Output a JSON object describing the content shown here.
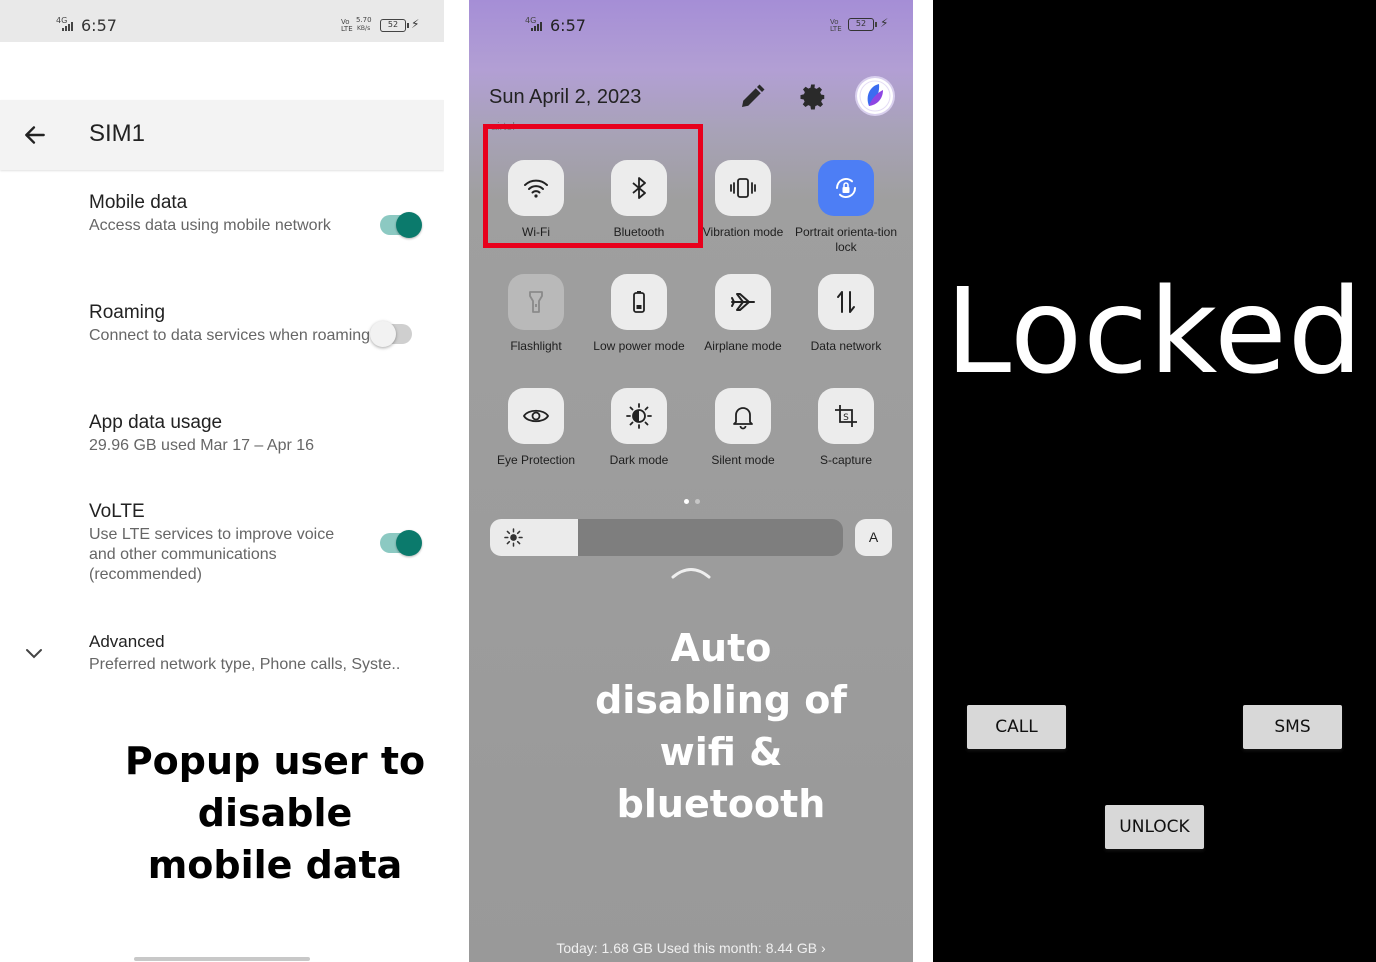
{
  "panel_settings": {
    "status": {
      "time": "6:57",
      "network": "4G",
      "speed_value": "5.70",
      "speed_unit": "KB/s",
      "battery": "52",
      "volte_tag": "Vo LTE"
    },
    "header": {
      "title": "SIM1",
      "back_icon": "arrow-left-icon"
    },
    "settings": [
      {
        "title": "Mobile data",
        "subtitle": "Access data using mobile network",
        "toggle": true
      },
      {
        "title": "Roaming",
        "subtitle": "Connect to data services when roaming",
        "toggle": false
      },
      {
        "title": "App data usage",
        "subtitle": "29.96 GB used Mar 17 – Apr 16"
      },
      {
        "title": "VoLTE",
        "subtitle": "Use LTE services to improve voice and other communications (recommended)",
        "toggle": true
      },
      {
        "title": "Advanced",
        "subtitle": "Preferred network type, Phone calls, Syste.."
      }
    ],
    "caption": "Popup user to disable mobile data",
    "colors": {
      "toggle_on": "#0b7a6c",
      "toggle_on_track": "#8cc9c2"
    }
  },
  "panel_quick": {
    "status": {
      "time": "6:57",
      "network": "4G",
      "battery": "52",
      "volte_tag": "Vo LTE"
    },
    "date": "Sun April 2, 2023",
    "hint": "airtel",
    "tiles": [
      {
        "label": "Wi-Fi",
        "icon": "wifi-icon"
      },
      {
        "label": "Bluetooth",
        "icon": "bluetooth-icon"
      },
      {
        "label": "Vibration mode",
        "icon": "vibration-icon"
      },
      {
        "label": "Portrait orienta-tion lock",
        "icon": "rotation-lock-icon",
        "active": true
      },
      {
        "label": "Flashlight",
        "icon": "flashlight-icon"
      },
      {
        "label": "Low power mode",
        "icon": "battery-icon"
      },
      {
        "label": "Airplane mode",
        "icon": "airplane-icon"
      },
      {
        "label": "Data network",
        "icon": "data-arrows-icon"
      },
      {
        "label": "Eye Protection",
        "icon": "eye-icon"
      },
      {
        "label": "Dark mode",
        "icon": "dark-mode-icon"
      },
      {
        "label": "Silent mode",
        "icon": "bell-icon"
      },
      {
        "label": "S-capture",
        "icon": "screenshot-icon"
      }
    ],
    "brightness_level": 0.25,
    "auto_brightness_label": "A",
    "caption": "Auto disabling of wifi & bluetooth",
    "usage": "Today: 1.68 GB Used this month: 8.44 GB ›",
    "colors": {
      "highlight": "#e8001c",
      "active_tile": "#4d7ef5"
    }
  },
  "panel_lock": {
    "title": "Locked",
    "buttons": {
      "call": "CALL",
      "sms": "SMS",
      "unlock": "UNLOCK"
    }
  }
}
